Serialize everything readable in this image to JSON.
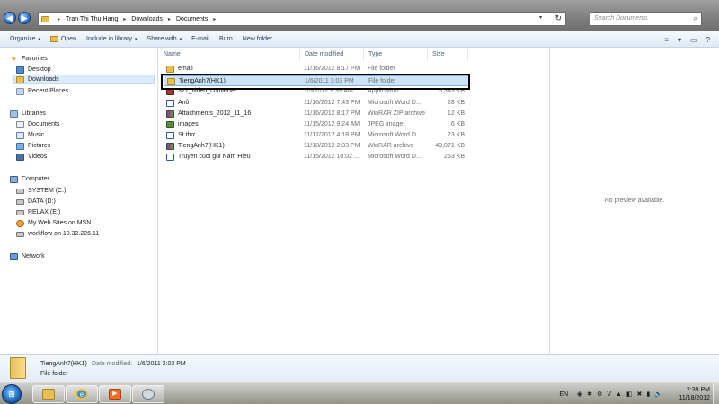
{
  "address": {
    "crumbs": [
      "Tran Thi Thu Hang",
      "Downloads",
      "Documents"
    ],
    "back_label": "◀",
    "forward_label": "▶",
    "dropdown_glyph": "▾",
    "refresh_glyph": "↻"
  },
  "search": {
    "placeholder": "Search Documents",
    "icon_glyph": "⌕"
  },
  "toolbar": {
    "organize": "Organize",
    "open": "Open",
    "include": "Include in library",
    "share": "Share with",
    "email": "E-mail",
    "burn": "Burn",
    "newfolder": "New folder",
    "arrow": "▾",
    "views_glyph": "≡",
    "preview_glyph": "▭",
    "help_glyph": "?"
  },
  "nav": {
    "favorites": "Favorites",
    "desktop": "Desktop",
    "downloads": "Downloads",
    "recent": "Recent Places",
    "libraries": "Libraries",
    "documents": "Documents",
    "music": "Music",
    "pictures": "Pictures",
    "videos": "Videos",
    "computer": "Computer",
    "drives": [
      "SYSTEM (C:)",
      "DATA (D:)",
      "RELAX (E:)",
      "My Web Sites on MSN",
      "workflow on 10.32.226.11"
    ],
    "network": "Network",
    "star_glyph": "★"
  },
  "columns": {
    "name": "Name",
    "date": "Date modified",
    "type": "Type",
    "size": "Size"
  },
  "files": [
    {
      "name": "email",
      "date": "11/16/2012 8:17 PM",
      "type": "File folder",
      "size": ""
    },
    {
      "name": "TiengAnh7(HK1)",
      "date": "1/6/2011 3:03 PM",
      "type": "File folder",
      "size": ""
    },
    {
      "name": "321_video_converter",
      "date": "1/5/2012 9:39 AM",
      "type": "Application",
      "size": "5,343 KB"
    },
    {
      "name": "Anô",
      "date": "11/16/2012 7:43 PM",
      "type": "Microsoft Word D...",
      "size": "28 KB"
    },
    {
      "name": "Attachments_2012_11_16",
      "date": "11/16/2012 8:17 PM",
      "type": "WinRAR ZIP archive",
      "size": "12 KB"
    },
    {
      "name": "images",
      "date": "11/15/2012 9:24 AM",
      "type": "JPEG image",
      "size": "6 KB"
    },
    {
      "name": "St thơ",
      "date": "11/17/2012 4:18 PM",
      "type": "Microsoft Word D...",
      "size": "23 KB"
    },
    {
      "name": "TiengAnh7(HK1)",
      "date": "11/18/2012 2:33 PM",
      "type": "WinRAR archive",
      "size": "49,071 KB"
    },
    {
      "name": "Truyen cuoi gui Nam Hieu",
      "date": "11/15/2012 10:02 ...",
      "type": "Microsoft Word D...",
      "size": "253 KB"
    }
  ],
  "preview": {
    "message": "No preview available."
  },
  "details": {
    "name": "TiengAnh7(HK1)",
    "date_label": "Date modified:",
    "date": "1/6/2011 3:03 PM",
    "type": "File folder"
  },
  "taskbar": {
    "start_glyph": "⊞",
    "ie_glyph": "e",
    "media_glyph": "▶",
    "lang": "EN",
    "time": "2:39 PM",
    "date": "11/18/2012",
    "tray_glyphs": [
      "◉",
      "✱",
      "⚙",
      "V",
      "▲",
      "◧",
      "✖",
      "▮",
      "🔊"
    ]
  },
  "colors": {
    "selection": "#cce4fa",
    "selection_border": "#84acdd",
    "folder": "#e8c050",
    "link_blue": "#1e395b"
  }
}
